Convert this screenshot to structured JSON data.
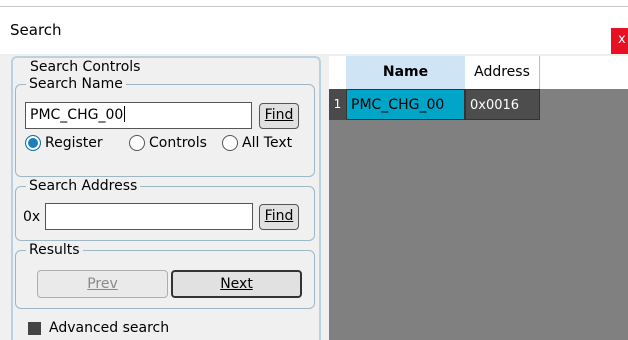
{
  "window": {
    "title": "Search",
    "close_label": "x"
  },
  "search_controls": {
    "legend": "Search Controls",
    "search_name": {
      "legend": "Search Name",
      "input_value": "PMC_CHG_00",
      "find_label": "Find",
      "options": [
        {
          "label": "Register",
          "selected": true
        },
        {
          "label": "Controls",
          "selected": false
        },
        {
          "label": "All Text",
          "selected": false
        }
      ]
    },
    "search_address": {
      "legend": "Search Address",
      "prefix": "0x",
      "input_value": "",
      "find_label": "Find"
    },
    "results": {
      "legend": "Results",
      "prev_label": "Prev",
      "next_label": "Next"
    },
    "advanced_label": "Advanced search"
  },
  "grid": {
    "columns": [
      "Name",
      "Address"
    ],
    "rows": [
      {
        "index": "1",
        "name": "PMC_CHG_00",
        "address": "0x0016"
      }
    ]
  },
  "colors": {
    "accent_selected": "#00a5c7",
    "header_name_bg": "#cfe4f5",
    "close_red": "#e81123"
  }
}
